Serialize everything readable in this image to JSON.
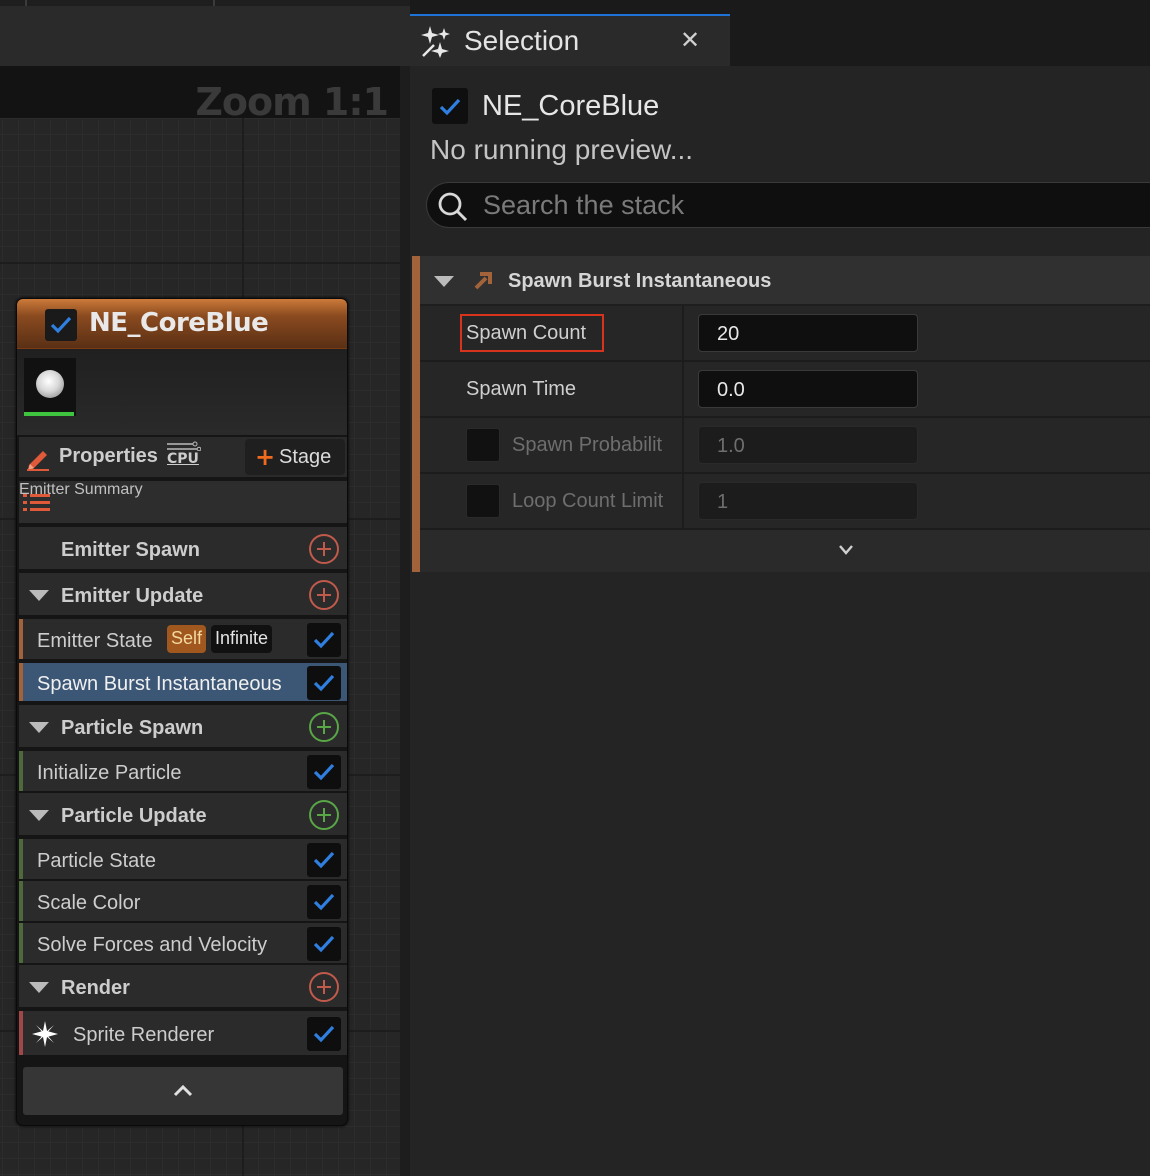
{
  "graph": {
    "zoom_label": "Zoom 1:1"
  },
  "node": {
    "title": "NE_CoreBlue",
    "properties_label": "Properties",
    "cpu_label": "CPU",
    "stage_label": "Stage",
    "sections": [
      {
        "label": "Emitter Summary"
      },
      {
        "label": "Emitter Spawn"
      },
      {
        "label": "Emitter Update"
      },
      {
        "label": "Particle Spawn"
      },
      {
        "label": "Particle Update"
      },
      {
        "label": "Render"
      }
    ],
    "modules": [
      {
        "label": "Emitter State",
        "badge1": "Self",
        "badge2": "Infinite"
      },
      {
        "label": "Spawn Burst Instantaneous"
      },
      {
        "label": "Initialize Particle"
      },
      {
        "label": "Particle State"
      },
      {
        "label": "Scale Color"
      },
      {
        "label": "Solve Forces and Velocity"
      },
      {
        "label": "Sprite Renderer"
      }
    ]
  },
  "panel": {
    "tab_title": "Selection",
    "emitter_name": "NE_CoreBlue",
    "preview_status": "No running preview...",
    "search_placeholder": "Search the stack",
    "module_title": "Spawn Burst Instantaneous",
    "params": [
      {
        "label": "Spawn Count",
        "value": "20"
      },
      {
        "label": "Spawn Time",
        "value": "0.0"
      },
      {
        "label": "Spawn Probabilit",
        "value": "1.0"
      },
      {
        "label": "Loop Count Limit",
        "value": "1"
      }
    ]
  },
  "colors": {
    "accent_orange": "#a2633a",
    "check_blue": "#2f7fe0",
    "add_red": "#c05a4a",
    "add_green": "#58a646",
    "selected_row": "#3c5776",
    "highlight_red": "#d8341d"
  }
}
